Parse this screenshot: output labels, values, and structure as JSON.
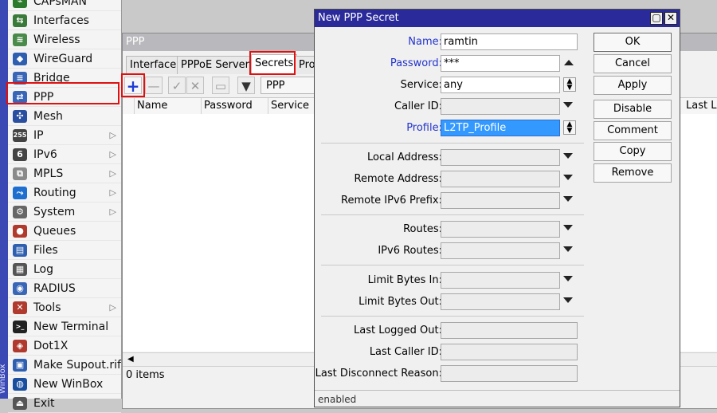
{
  "sidebar": {
    "brand_vertical": "WinBox",
    "items": [
      {
        "label": "CAPsMAN",
        "icon": "capsman-icon",
        "has_sub": false
      },
      {
        "label": "Interfaces",
        "icon": "interfaces-icon",
        "has_sub": false
      },
      {
        "label": "Wireless",
        "icon": "wireless-icon",
        "has_sub": false
      },
      {
        "label": "WireGuard",
        "icon": "wireguard-icon",
        "has_sub": false
      },
      {
        "label": "Bridge",
        "icon": "bridge-icon",
        "has_sub": false
      },
      {
        "label": "PPP",
        "icon": "ppp-icon",
        "has_sub": false
      },
      {
        "label": "Mesh",
        "icon": "mesh-icon",
        "has_sub": false
      },
      {
        "label": "IP",
        "icon": "ip-icon",
        "has_sub": true
      },
      {
        "label": "IPv6",
        "icon": "ipv6-icon",
        "has_sub": true
      },
      {
        "label": "MPLS",
        "icon": "mpls-icon",
        "has_sub": true
      },
      {
        "label": "Routing",
        "icon": "routing-icon",
        "has_sub": true
      },
      {
        "label": "System",
        "icon": "system-icon",
        "has_sub": true
      },
      {
        "label": "Queues",
        "icon": "queues-icon",
        "has_sub": false
      },
      {
        "label": "Files",
        "icon": "files-icon",
        "has_sub": false
      },
      {
        "label": "Log",
        "icon": "log-icon",
        "has_sub": false
      },
      {
        "label": "RADIUS",
        "icon": "radius-icon",
        "has_sub": false
      },
      {
        "label": "Tools",
        "icon": "tools-icon",
        "has_sub": true
      },
      {
        "label": "New Terminal",
        "icon": "terminal-icon",
        "has_sub": false
      },
      {
        "label": "Dot1X",
        "icon": "dot1x-icon",
        "has_sub": false
      },
      {
        "label": "Make Supout.rif",
        "icon": "supout-icon",
        "has_sub": false
      },
      {
        "label": "New WinBox",
        "icon": "winbox-icon",
        "has_sub": false
      },
      {
        "label": "Exit",
        "icon": "exit-icon",
        "has_sub": false
      }
    ],
    "selected": "PPP"
  },
  "ppp_window": {
    "title": "PPP",
    "tabs": [
      "Interface",
      "PPPoE Servers",
      "Secrets",
      "Profiles"
    ],
    "active_tab": "Secrets",
    "filter_button_label": "PPP Authentication&Accounting",
    "columns": [
      "Name",
      "Password",
      "Service",
      "Last Logged Out"
    ],
    "status": "0 items"
  },
  "dialog": {
    "title": "New PPP Secret",
    "fields": {
      "name": {
        "label": "Name:",
        "value": "ramtin"
      },
      "password": {
        "label": "Password:",
        "value": "***"
      },
      "service": {
        "label": "Service:",
        "value": "any"
      },
      "caller_id": {
        "label": "Caller ID:",
        "value": ""
      },
      "profile": {
        "label": "Profile:",
        "value": "L2TP_Profile"
      },
      "local_address": {
        "label": "Local Address:",
        "value": ""
      },
      "remote_address": {
        "label": "Remote Address:",
        "value": ""
      },
      "remote_ipv6_prefix": {
        "label": "Remote IPv6 Prefix:",
        "value": ""
      },
      "routes": {
        "label": "Routes:",
        "value": ""
      },
      "ipv6_routes": {
        "label": "IPv6 Routes:",
        "value": ""
      },
      "limit_bytes_in": {
        "label": "Limit Bytes In:",
        "value": ""
      },
      "limit_bytes_out": {
        "label": "Limit Bytes Out:",
        "value": ""
      },
      "last_logged_out": {
        "label": "Last Logged Out:",
        "value": ""
      },
      "last_caller_id": {
        "label": "Last Caller ID:",
        "value": ""
      },
      "last_disconnect_reason": {
        "label": "Last Disconnect Reason:",
        "value": ""
      }
    },
    "buttons": [
      "OK",
      "Cancel",
      "Apply",
      "Disable",
      "Comment",
      "Copy",
      "Remove"
    ],
    "status": "enabled"
  },
  "colors": {
    "highlight": "#e01010",
    "dialog_title_bg": "#2a2a9b",
    "selection": "#3399ff",
    "add_button": "#1d3bd6"
  }
}
